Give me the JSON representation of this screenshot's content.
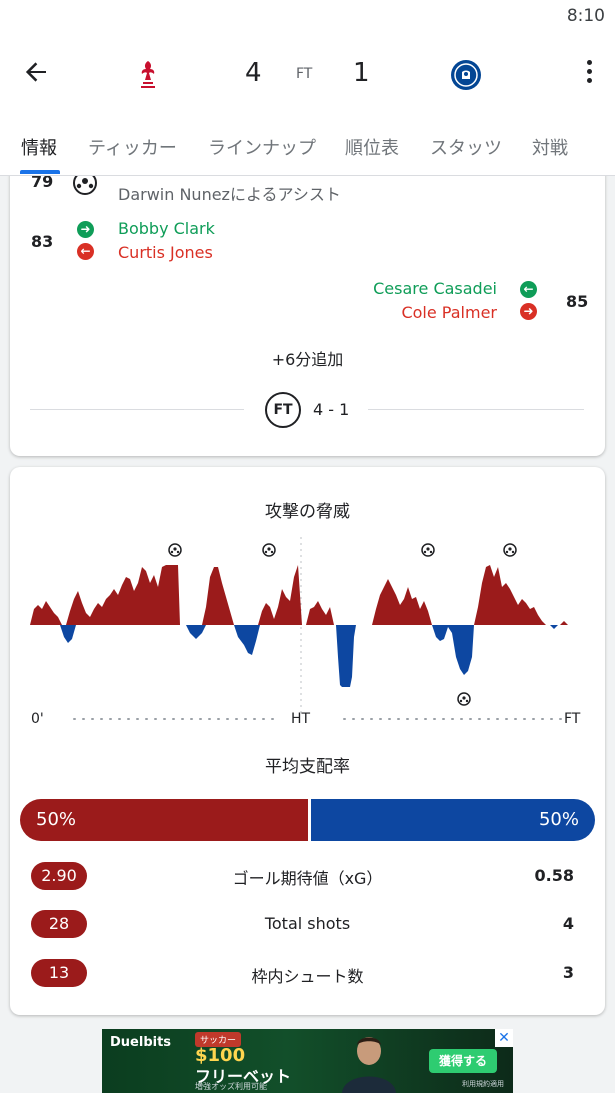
{
  "status": {
    "time": "8:10"
  },
  "header": {
    "home_score": "4",
    "away_score": "1",
    "status_label": "FT"
  },
  "tabs": [
    "情報",
    "ティッカー",
    "ラインナップ",
    "順位表",
    "スタッツ",
    "対戦"
  ],
  "events": {
    "goal_79": {
      "minute": "79",
      "assist": "Darwin Nunezによるアシスト"
    },
    "sub_83": {
      "minute": "83",
      "in": "Bobby Clark",
      "out": "Curtis Jones"
    },
    "sub_85": {
      "minute": "85",
      "in": "Cesare Casadei",
      "out": "Cole Palmer"
    },
    "added_time": "+6分追加",
    "final": {
      "badge": "FT",
      "score": "4 - 1"
    }
  },
  "momentum": {
    "title": "攻撃の脅威",
    "axis": {
      "start": "0'",
      "half": "HT",
      "end": "FT"
    }
  },
  "possession": {
    "title": "平均支配率",
    "home": "50%",
    "away": "50%"
  },
  "stats": [
    {
      "label": "ゴール期待値（xG）",
      "home": "2.90",
      "away": "0.58"
    },
    {
      "label": "Total shots",
      "home": "28",
      "away": "4"
    },
    {
      "label": "枠内シュート数",
      "home": "13",
      "away": "3"
    }
  ],
  "ad": {
    "brand": "Duelbits",
    "tag": "サッカー",
    "amount": "$100",
    "headline": "フリーベット",
    "sub": "増強オッズ利用可能",
    "cta": "獲得する",
    "note": "利用規約適用",
    "close": "✕"
  },
  "colors": {
    "home": "#9b1b1b",
    "away": "#0d47a1",
    "accent": "#1a73e8",
    "sub_in": "#0f9d58",
    "sub_out": "#d93025"
  }
}
